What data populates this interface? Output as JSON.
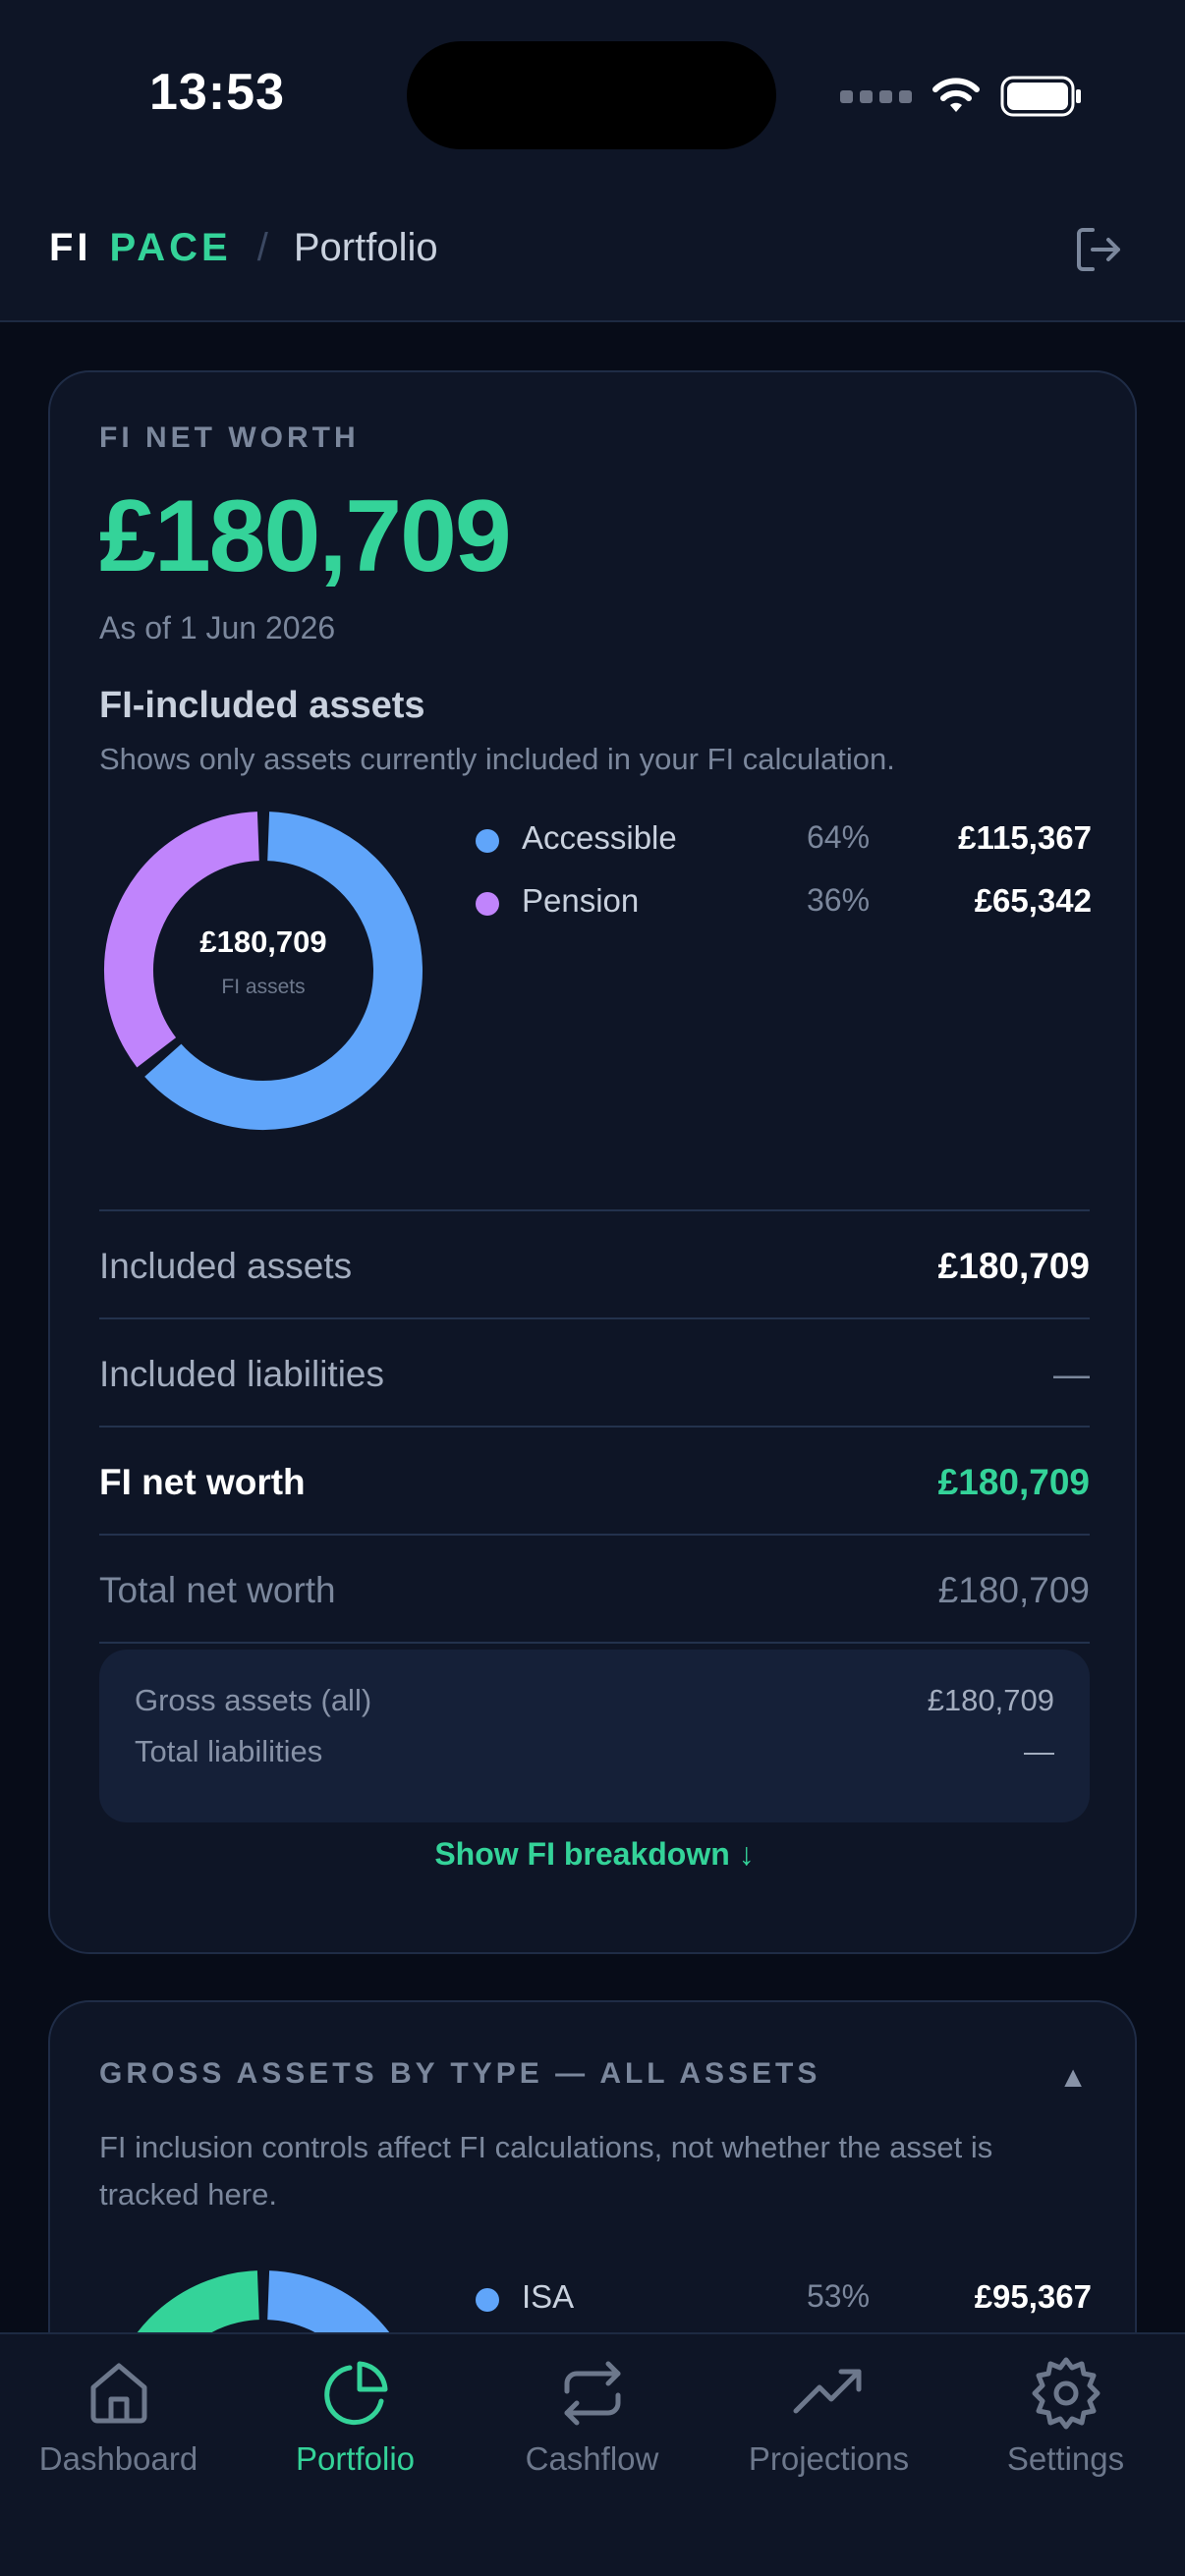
{
  "status_bar": {
    "time": "13:53"
  },
  "header": {
    "brand_fi": "FI",
    "brand_pace": "PACE",
    "separator": "/",
    "page": "Portfolio"
  },
  "net_worth_card": {
    "eyebrow": "FI NET WORTH",
    "value": "£180,709",
    "as_of": "As of 1 Jun 2026",
    "section_title": "FI-included assets",
    "section_subtitle": "Shows only assets currently included in your FI calculation.",
    "donut_center_value": "£180,709",
    "donut_center_label": "FI assets",
    "legend": [
      {
        "name": "Accessible",
        "pct": "64%",
        "value": "£115,367",
        "color": "#60a5fa",
        "share": 0.64
      },
      {
        "name": "Pension",
        "pct": "36%",
        "value": "£65,342",
        "color": "#c084fc",
        "share": 0.36
      }
    ],
    "rows": [
      {
        "label": "Included assets",
        "value": "£180,709"
      },
      {
        "label": "Included liabilities",
        "value": "—"
      },
      {
        "label": "FI net worth",
        "value": "£180,709"
      },
      {
        "label": "Total net worth",
        "value": "£180,709"
      }
    ],
    "gross_box": {
      "assets_label": "Gross assets (all)",
      "assets_value": "£180,709",
      "liabilities_label": "Total liabilities",
      "liabilities_value": "—"
    },
    "show_breakdown": "Show FI breakdown ↓"
  },
  "gross_card": {
    "eyebrow": "GROSS ASSETS BY TYPE — ALL ASSETS",
    "collapse_icon": "▲",
    "subtitle": "FI inclusion controls affect FI calculations, not whether the asset is tracked here.",
    "legend": [
      {
        "name": "ISA",
        "pct": "53%",
        "value": "£95,367",
        "color": "#60a5fa",
        "share": 0.53
      }
    ],
    "donut_segments": [
      {
        "color": "#60a5fa",
        "share": 0.53
      },
      {
        "color": "#c084fc",
        "share": 0.04
      },
      {
        "color": "#34d399",
        "share": 0.43
      }
    ]
  },
  "nav": {
    "items": [
      {
        "label": "Dashboard",
        "icon": "home-icon"
      },
      {
        "label": "Portfolio",
        "icon": "pie-chart-icon",
        "active": true
      },
      {
        "label": "Cashflow",
        "icon": "repeat-icon"
      },
      {
        "label": "Projections",
        "icon": "trending-up-icon"
      },
      {
        "label": "Settings",
        "icon": "gear-icon"
      }
    ]
  },
  "colors": {
    "accent": "#34d399",
    "accessible": "#60a5fa",
    "pension": "#c084fc",
    "background": "#0e1526"
  }
}
